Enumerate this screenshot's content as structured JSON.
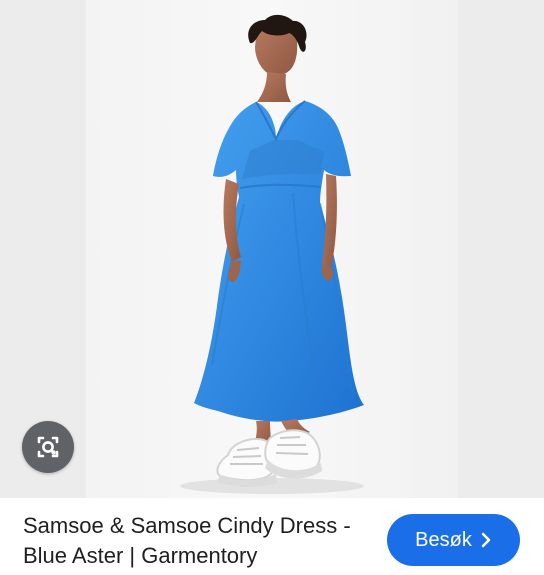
{
  "result": {
    "title": "Samsoe & Samsoe Cindy Dress - Blue Aster | Garmentory",
    "visit_label": "Besøk"
  },
  "icons": {
    "lens": "image-search-icon",
    "chevron": "chevron-right-icon"
  },
  "colors": {
    "dress": "#2f87df",
    "button": "#1a6fe8",
    "lens_button": "#5f6368"
  }
}
